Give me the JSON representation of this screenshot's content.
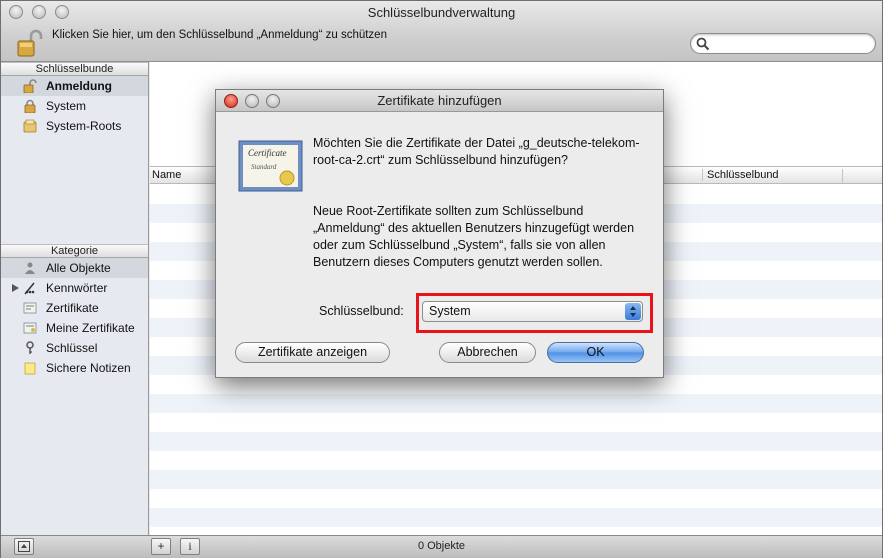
{
  "window": {
    "title": "Schlüsselbundverwaltung",
    "lock_hint": "Klicken Sie hier, um den Schlüsselbund „Anmeldung“ zu schützen",
    "search_placeholder": ""
  },
  "sidebar": {
    "keychains_header": "Schlüsselbunde",
    "keychains": [
      {
        "label": "Anmeldung",
        "icon": "unlocked-keychain-icon",
        "selected": true
      },
      {
        "label": "System",
        "icon": "locked-keychain-icon"
      },
      {
        "label": "System-Roots",
        "icon": "keychain-folder-icon"
      }
    ],
    "category_header": "Kategorie",
    "categories": [
      {
        "label": "Alle Objekte",
        "icon": "all-items-icon",
        "selected": true
      },
      {
        "label": "Kennwörter",
        "icon": "passwords-icon",
        "expandable": true
      },
      {
        "label": "Zertifikate",
        "icon": "certificate-icon"
      },
      {
        "label": "Meine Zertifikate",
        "icon": "my-certificates-icon"
      },
      {
        "label": "Schlüssel",
        "icon": "key-icon"
      },
      {
        "label": "Sichere Notizen",
        "icon": "secure-note-icon"
      }
    ]
  },
  "table": {
    "columns": [
      "Name",
      "Schlüsselbund"
    ]
  },
  "bottombar": {
    "status": "0 Objekte",
    "add_label": "+",
    "info_label": "i"
  },
  "dialog": {
    "title": "Zertifikate hinzufügen",
    "message": "Möchten Sie die Zertifikate der Datei „g_deutsche-telekom-root-ca-2.crt“ zum Schlüsselbund hinzufügen?",
    "info": "Neue Root-Zertifikate sollten zum Schlüsselbund „Anmeldung“ des aktuellen Benutzers hinzugefügt werden oder zum Schlüsselbund „System“, falls sie von allen Benutzern dieses Computers genutzt werden sollen.",
    "keychain_label": "Schlüsselbund:",
    "keychain_value": "System",
    "show_certs_button": "Zertifikate anzeigen",
    "cancel_button": "Abbrechen",
    "ok_button": "OK",
    "cert_icon_text": [
      "Certificate",
      "Standard"
    ],
    "highlight_color": "#e8141a"
  },
  "colors": {
    "selection": "#d3d7de",
    "accent_button": "#5b9be8"
  }
}
